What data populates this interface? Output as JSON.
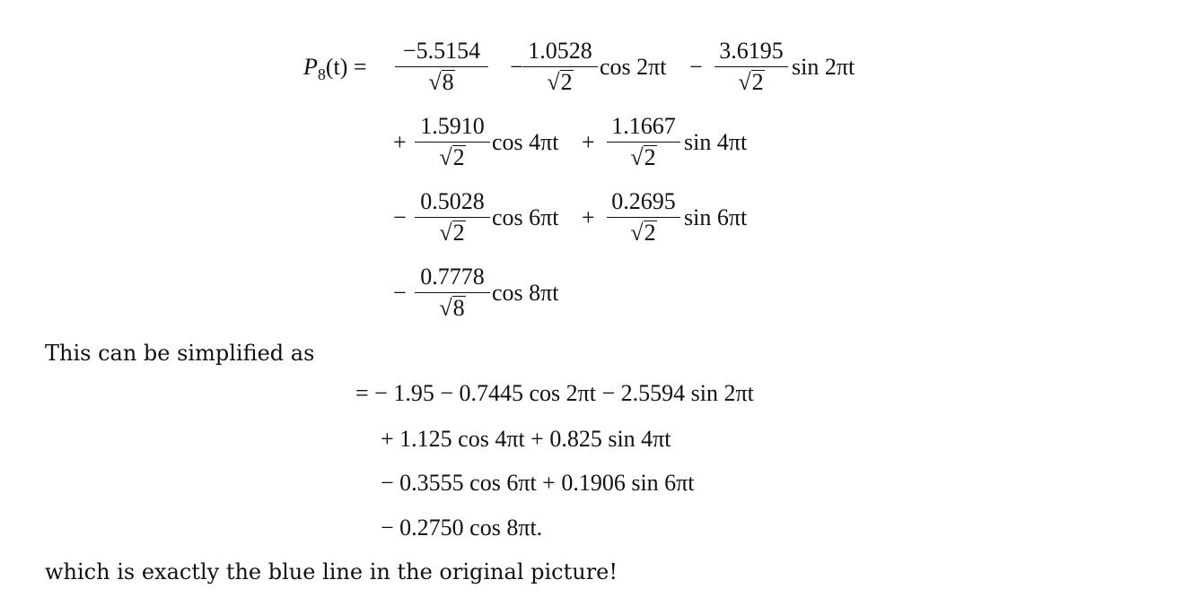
{
  "lhs": "P",
  "lhs_sub": "8",
  "lhs_arg": "(t) =",
  "rows": [
    {
      "lead_op": "",
      "terms": [
        {
          "num": "−5.5154",
          "den": "8",
          "func": ""
        },
        {
          "op": "−",
          "num": "1.0528",
          "den": "2",
          "func": "cos 2πt"
        },
        {
          "op": "−",
          "num": "3.6195",
          "den": "2",
          "func": "sin 2πt"
        }
      ]
    },
    {
      "lead_op": "+",
      "terms": [
        {
          "num": "1.5910",
          "den": "2",
          "func": "cos 4πt"
        },
        {
          "op": "+",
          "num": "1.1667",
          "den": "2",
          "func": "sin 4πt"
        }
      ]
    },
    {
      "lead_op": "−",
      "terms": [
        {
          "num": "0.5028",
          "den": "2",
          "func": "cos 6πt"
        },
        {
          "op": "+",
          "num": "0.2695",
          "den": "2",
          "func": "sin 6πt"
        }
      ]
    },
    {
      "lead_op": "−",
      "terms": [
        {
          "num": "0.7778",
          "den": "8",
          "func": "cos 8πt"
        }
      ]
    }
  ],
  "text1": "This can be simplified as",
  "simplified": [
    "= − 1.95 − 0.7445 cos 2πt − 2.5594 sin 2πt",
    "+ 1.125 cos 4πt + 0.825 sin 4πt",
    "− 0.3555 cos 6πt + 0.1906 sin 6πt",
    "− 0.2750 cos 8πt."
  ],
  "text2": "which is exactly the blue line in the original picture!"
}
